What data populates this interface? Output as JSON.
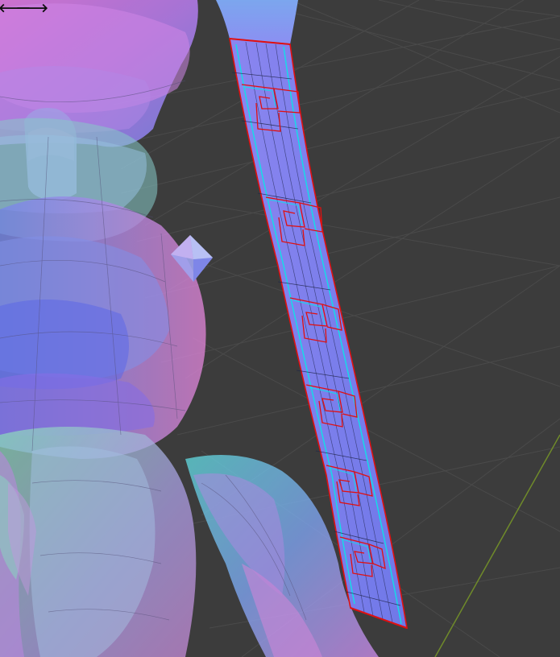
{
  "app": {
    "view": "3d-viewport",
    "shading": "normal-map-xray",
    "colors": {
      "background": "#3c3c3c",
      "grid_line": "#4a4a4a",
      "grid_axis_y": "#6f8a2a",
      "edge_selected": "#e01010",
      "edge_active": "#10e0e8"
    }
  },
  "nav": {
    "back_icon": "arrow-left-icon",
    "back_glyph": "🡐",
    "forward_icon": "arrow-right-icon",
    "forward_glyph": "🡒"
  }
}
